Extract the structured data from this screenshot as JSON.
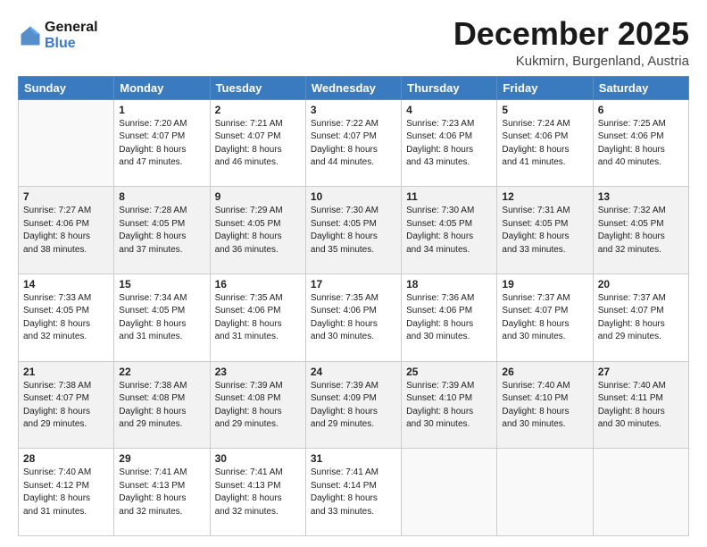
{
  "header": {
    "logo_line1": "General",
    "logo_line2": "Blue",
    "month": "December 2025",
    "location": "Kukmirn, Burgenland, Austria"
  },
  "days_of_week": [
    "Sunday",
    "Monday",
    "Tuesday",
    "Wednesday",
    "Thursday",
    "Friday",
    "Saturday"
  ],
  "weeks": [
    [
      {
        "day": "",
        "info": ""
      },
      {
        "day": "1",
        "info": "Sunrise: 7:20 AM\nSunset: 4:07 PM\nDaylight: 8 hours\nand 47 minutes."
      },
      {
        "day": "2",
        "info": "Sunrise: 7:21 AM\nSunset: 4:07 PM\nDaylight: 8 hours\nand 46 minutes."
      },
      {
        "day": "3",
        "info": "Sunrise: 7:22 AM\nSunset: 4:07 PM\nDaylight: 8 hours\nand 44 minutes."
      },
      {
        "day": "4",
        "info": "Sunrise: 7:23 AM\nSunset: 4:06 PM\nDaylight: 8 hours\nand 43 minutes."
      },
      {
        "day": "5",
        "info": "Sunrise: 7:24 AM\nSunset: 4:06 PM\nDaylight: 8 hours\nand 41 minutes."
      },
      {
        "day": "6",
        "info": "Sunrise: 7:25 AM\nSunset: 4:06 PM\nDaylight: 8 hours\nand 40 minutes."
      }
    ],
    [
      {
        "day": "7",
        "info": "Sunrise: 7:27 AM\nSunset: 4:06 PM\nDaylight: 8 hours\nand 38 minutes."
      },
      {
        "day": "8",
        "info": "Sunrise: 7:28 AM\nSunset: 4:05 PM\nDaylight: 8 hours\nand 37 minutes."
      },
      {
        "day": "9",
        "info": "Sunrise: 7:29 AM\nSunset: 4:05 PM\nDaylight: 8 hours\nand 36 minutes."
      },
      {
        "day": "10",
        "info": "Sunrise: 7:30 AM\nSunset: 4:05 PM\nDaylight: 8 hours\nand 35 minutes."
      },
      {
        "day": "11",
        "info": "Sunrise: 7:30 AM\nSunset: 4:05 PM\nDaylight: 8 hours\nand 34 minutes."
      },
      {
        "day": "12",
        "info": "Sunrise: 7:31 AM\nSunset: 4:05 PM\nDaylight: 8 hours\nand 33 minutes."
      },
      {
        "day": "13",
        "info": "Sunrise: 7:32 AM\nSunset: 4:05 PM\nDaylight: 8 hours\nand 32 minutes."
      }
    ],
    [
      {
        "day": "14",
        "info": "Sunrise: 7:33 AM\nSunset: 4:05 PM\nDaylight: 8 hours\nand 32 minutes."
      },
      {
        "day": "15",
        "info": "Sunrise: 7:34 AM\nSunset: 4:05 PM\nDaylight: 8 hours\nand 31 minutes."
      },
      {
        "day": "16",
        "info": "Sunrise: 7:35 AM\nSunset: 4:06 PM\nDaylight: 8 hours\nand 31 minutes."
      },
      {
        "day": "17",
        "info": "Sunrise: 7:35 AM\nSunset: 4:06 PM\nDaylight: 8 hours\nand 30 minutes."
      },
      {
        "day": "18",
        "info": "Sunrise: 7:36 AM\nSunset: 4:06 PM\nDaylight: 8 hours\nand 30 minutes."
      },
      {
        "day": "19",
        "info": "Sunrise: 7:37 AM\nSunset: 4:07 PM\nDaylight: 8 hours\nand 30 minutes."
      },
      {
        "day": "20",
        "info": "Sunrise: 7:37 AM\nSunset: 4:07 PM\nDaylight: 8 hours\nand 29 minutes."
      }
    ],
    [
      {
        "day": "21",
        "info": "Sunrise: 7:38 AM\nSunset: 4:07 PM\nDaylight: 8 hours\nand 29 minutes."
      },
      {
        "day": "22",
        "info": "Sunrise: 7:38 AM\nSunset: 4:08 PM\nDaylight: 8 hours\nand 29 minutes."
      },
      {
        "day": "23",
        "info": "Sunrise: 7:39 AM\nSunset: 4:08 PM\nDaylight: 8 hours\nand 29 minutes."
      },
      {
        "day": "24",
        "info": "Sunrise: 7:39 AM\nSunset: 4:09 PM\nDaylight: 8 hours\nand 29 minutes."
      },
      {
        "day": "25",
        "info": "Sunrise: 7:39 AM\nSunset: 4:10 PM\nDaylight: 8 hours\nand 30 minutes."
      },
      {
        "day": "26",
        "info": "Sunrise: 7:40 AM\nSunset: 4:10 PM\nDaylight: 8 hours\nand 30 minutes."
      },
      {
        "day": "27",
        "info": "Sunrise: 7:40 AM\nSunset: 4:11 PM\nDaylight: 8 hours\nand 30 minutes."
      }
    ],
    [
      {
        "day": "28",
        "info": "Sunrise: 7:40 AM\nSunset: 4:12 PM\nDaylight: 8 hours\nand 31 minutes."
      },
      {
        "day": "29",
        "info": "Sunrise: 7:41 AM\nSunset: 4:13 PM\nDaylight: 8 hours\nand 32 minutes."
      },
      {
        "day": "30",
        "info": "Sunrise: 7:41 AM\nSunset: 4:13 PM\nDaylight: 8 hours\nand 32 minutes."
      },
      {
        "day": "31",
        "info": "Sunrise: 7:41 AM\nSunset: 4:14 PM\nDaylight: 8 hours\nand 33 minutes."
      },
      {
        "day": "",
        "info": ""
      },
      {
        "day": "",
        "info": ""
      },
      {
        "day": "",
        "info": ""
      }
    ]
  ]
}
